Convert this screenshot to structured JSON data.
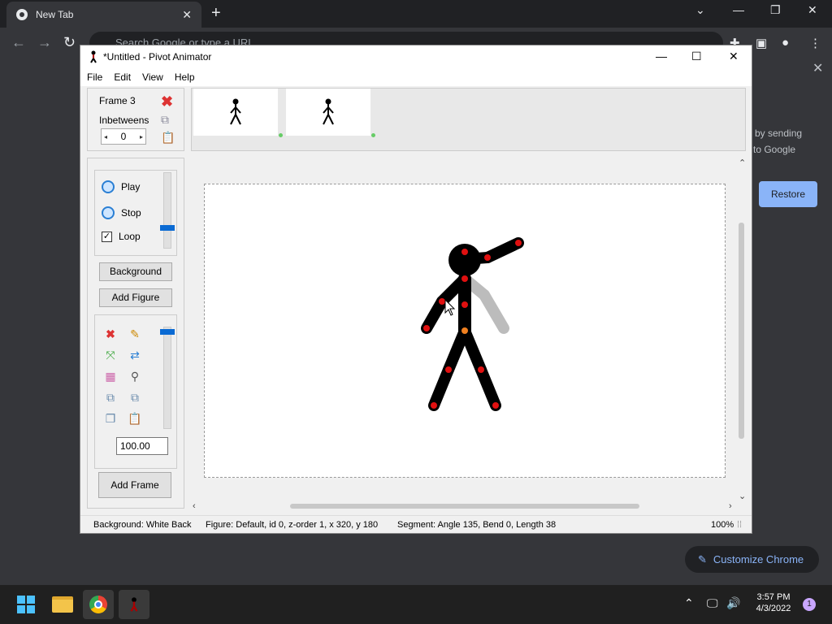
{
  "chrome": {
    "tab_title": "New Tab",
    "omnibox_placeholder": "Search Google or type a URL",
    "side_text_1": "by sending",
    "side_text_2": "to Google",
    "restore_label": "Restore",
    "customize_label": "Customize Chrome"
  },
  "window": {
    "title": "*Untitled - Pivot Animator",
    "menu": [
      "File",
      "Edit",
      "View",
      "Help"
    ]
  },
  "frame_panel": {
    "frame_label": "Frame 3",
    "inbetweens_label": "Inbetweens",
    "inbetweens_value": "0"
  },
  "play_panel": {
    "play_label": "Play",
    "stop_label": "Stop",
    "loop_label": "Loop",
    "loop_checked": true,
    "background_label": "Background",
    "add_figure_label": "Add Figure",
    "scale_value": "100.00",
    "add_frame_label": "Add Frame"
  },
  "status": {
    "background": "Background: White Back",
    "figure": "Figure: Default,  id 0,  z-order 1,  x 320, y 180",
    "segment": "Segment: Angle 135,  Bend 0,  Length 38",
    "zoom": "100%"
  },
  "taskbar": {
    "time": "3:57 PM",
    "date": "4/3/2022",
    "notifications": "1"
  },
  "colors": {
    "joint": "#e01010",
    "pivot_joint": "#f08020",
    "figure": "#000000",
    "ghost": "#bcbcbc",
    "accent": "#8ab4f8"
  }
}
